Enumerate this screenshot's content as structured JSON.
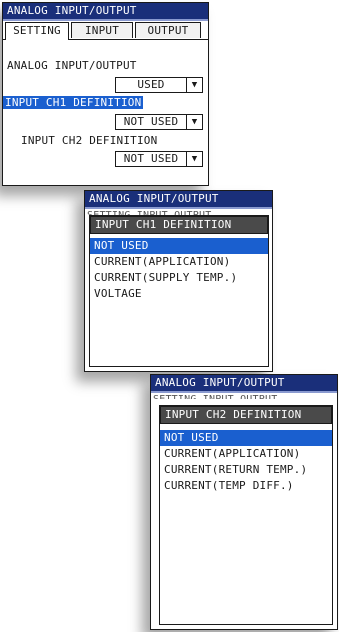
{
  "panel1": {
    "title": "ANALOG INPUT/OUTPUT",
    "tabs": [
      "SETTING",
      "INPUT",
      "OUTPUT"
    ],
    "analog_label": "ANALOG INPUT/OUTPUT",
    "analog_value": "USED",
    "ch1_label": "INPUT CH1 DEFINITION",
    "ch1_value": "NOT USED",
    "ch2_label": "INPUT CH2 DEFINITION",
    "ch2_value": "NOT USED"
  },
  "panel2": {
    "title": "ANALOG INPUT/OUTPUT",
    "ghost_tabs": "SETTING   INPUT   OUTPUT",
    "popup_title": "INPUT CH1 DEFINITION",
    "options": [
      "NOT USED",
      "CURRENT(APPLICATION)",
      "CURRENT(SUPPLY TEMP.)",
      "VOLTAGE"
    ],
    "selected": "NOT USED"
  },
  "panel3": {
    "title": "ANALOG INPUT/OUTPUT",
    "ghost_tabs": "SETTING   INPUT   OUTPUT",
    "popup_title": "INPUT CH2 DEFINITION",
    "options": [
      "NOT USED",
      "CURRENT(APPLICATION)",
      "CURRENT(RETURN TEMP.)",
      "CURRENT(TEMP DIFF.)"
    ],
    "selected": "NOT USED"
  },
  "icons": {
    "dropdown": "triangle-down-icon"
  },
  "colors": {
    "title_bar": "#1a2f7a",
    "selection": "#1a5fcf",
    "popup_header": "#4a4a4a"
  }
}
